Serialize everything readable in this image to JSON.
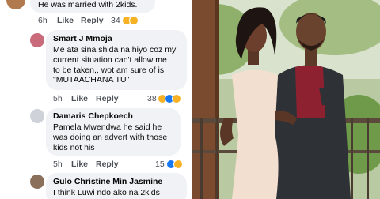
{
  "comments": [
    {
      "author": "",
      "body": "He was married with 2kids.",
      "time": "6h",
      "like_label": "Like",
      "reply_label": "Reply",
      "reactions": "34",
      "reaction_icons": [
        "haha-icon",
        "haha-icon"
      ]
    },
    {
      "author": "Smart J Mmoja",
      "body": "Me ata sina shida na hiyo coz my\ncurrent situation can't allow me\nto be  taken,, wot am sure of is\n\"MUTAACHANA TU\"",
      "time": "5h",
      "like_label": "Like",
      "reply_label": "Reply",
      "reactions": "38",
      "reaction_icons": [
        "haha-icon",
        "like-icon",
        "wow-icon"
      ]
    },
    {
      "author": "Damaris Chepkoech",
      "body": "Pamela Mwendwa he said he\nwas doing an advert with those\nkids not his",
      "time": "5h",
      "like_label": "Like",
      "reply_label": "Reply",
      "reactions": "15",
      "reaction_icons": [
        "like-icon",
        "haha-icon"
      ]
    },
    {
      "author": "Gulo Christine Min Jasmine",
      "body": "I think Luwi ndo ako na 2kids",
      "time": "",
      "like_label": "",
      "reply_label": "",
      "reactions": "",
      "reaction_icons": []
    }
  ],
  "photo": {
    "subject": "couple-photo",
    "colors": {
      "dress": "#f3dfcf",
      "sweater": "#8e2130",
      "jacket": "#2e3136",
      "foliage": "#6e9a4a"
    }
  }
}
